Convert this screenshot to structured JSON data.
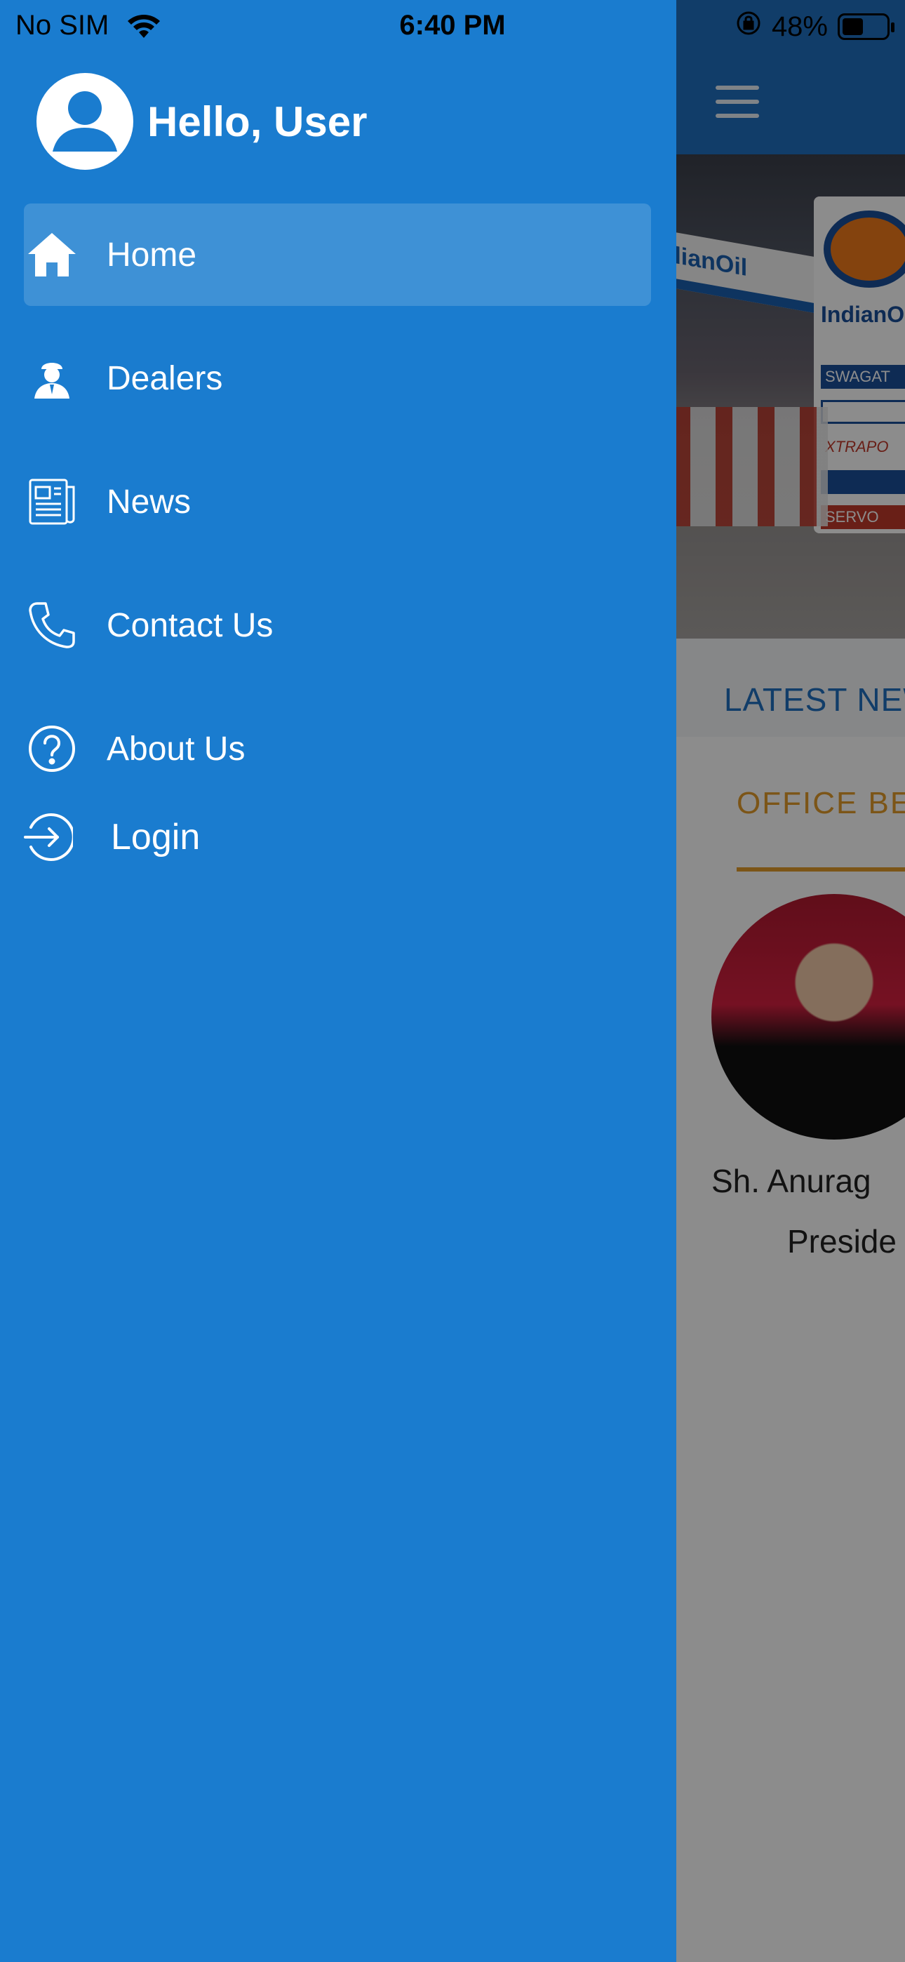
{
  "status_bar": {
    "carrier": "No SIM",
    "time": "6:40 PM",
    "battery": "48%",
    "battery_level": 0.48,
    "wifi_icon": "wifi-icon",
    "rotation_lock_icon": "rotation-lock-icon"
  },
  "drawer": {
    "greeting": "Hello, User",
    "background_color": "#1a7ccf",
    "items": [
      {
        "label": "Home",
        "icon": "home-icon",
        "active": true
      },
      {
        "label": "Dealers",
        "icon": "dealer-icon",
        "active": false
      },
      {
        "label": "News",
        "icon": "newspaper-icon",
        "active": false
      },
      {
        "label": "Contact Us",
        "icon": "phone-icon",
        "active": false
      },
      {
        "label": "About Us",
        "icon": "question-icon",
        "active": false
      },
      {
        "label": "Login",
        "icon": "login-icon",
        "active": false
      }
    ]
  },
  "background_page": {
    "header_color": "#1f6fc0",
    "menu_icon": "hamburger-icon",
    "news_label": "LATEST NEW",
    "section_label": "OFFICE BE",
    "person_name": "Sh. Anurag",
    "person_role": "Preside",
    "banner_text": "IndianOil",
    "canopy_text": "dianOil",
    "sign_lines": [
      "SWAGAT",
      "XTRAPO",
      "SERVO"
    ]
  }
}
